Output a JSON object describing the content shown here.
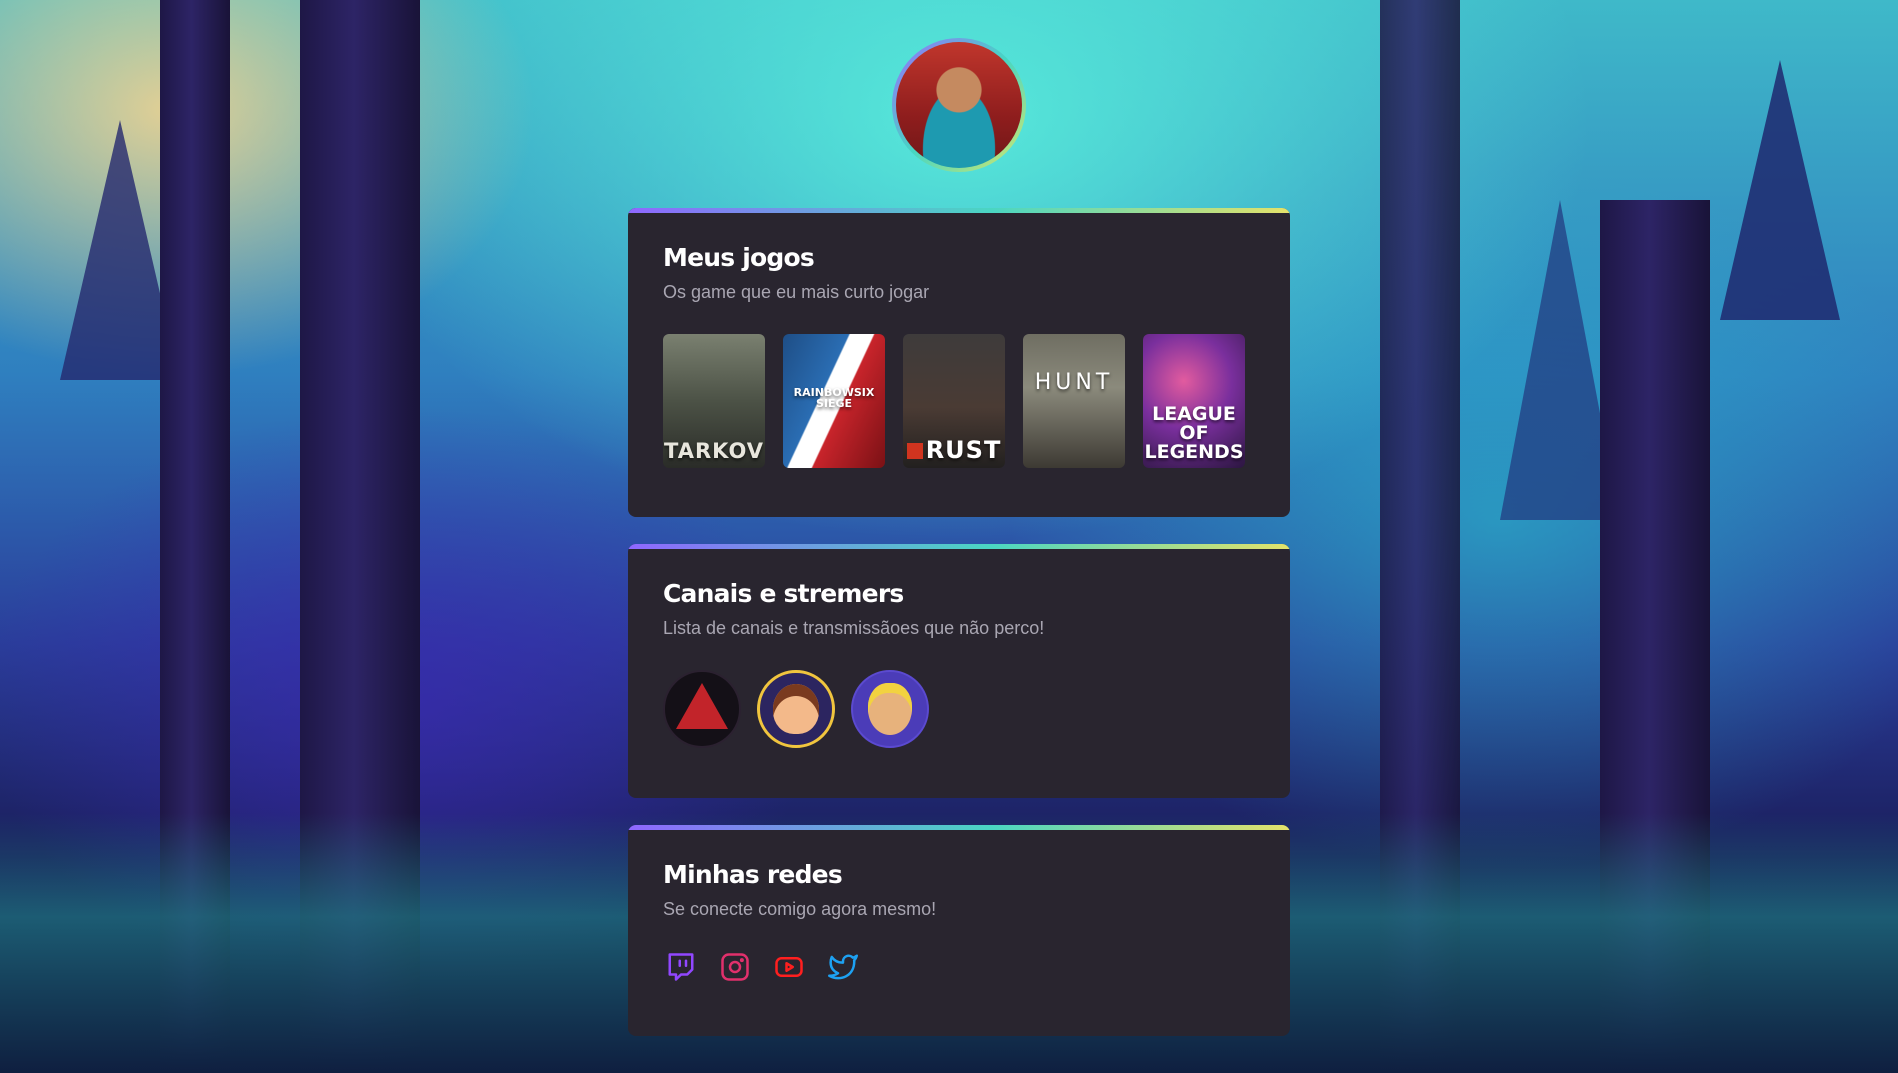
{
  "colors": {
    "card_bg": "#29252f",
    "accent_gradient": [
      "#8f67ff",
      "#4ad6c2",
      "#e4e26a"
    ],
    "twitch": "#9147ff",
    "instagram": "#e1306c",
    "youtube": "#ff0000",
    "twitter": "#1da1f2"
  },
  "profile": {
    "avatar_icon": "profile-photo"
  },
  "games_card": {
    "title": "Meus jogos",
    "subtitle": "Os game que eu mais curto jogar",
    "games": [
      {
        "name": "ESCAPE FROM TARKOV",
        "logo": "TARKOV"
      },
      {
        "name": "RAINBOW SIX SIEGE",
        "logo": "RAINBOWSIX SIEGE"
      },
      {
        "name": "RUST",
        "logo": "RUST"
      },
      {
        "name": "HUNT",
        "logo": "HUNT"
      },
      {
        "name": "LEAGUE OF LEGENDS",
        "logo": "LEAGUE OF LEGENDS"
      }
    ]
  },
  "streamers_card": {
    "title": "Canais e stremers",
    "subtitle": "Lista de canais e transmissãoes que não perco!",
    "streamers": [
      {
        "icon": "hooded-figure-avatar"
      },
      {
        "icon": "cartoon-boy-avatar"
      },
      {
        "icon": "cartoon-man-avatar"
      }
    ]
  },
  "social_card": {
    "title": "Minhas redes",
    "subtitle": "Se conecte comigo agora mesmo!",
    "networks": [
      {
        "icon": "twitch-icon"
      },
      {
        "icon": "instagram-icon"
      },
      {
        "icon": "youtube-icon"
      },
      {
        "icon": "twitter-icon"
      }
    ]
  }
}
